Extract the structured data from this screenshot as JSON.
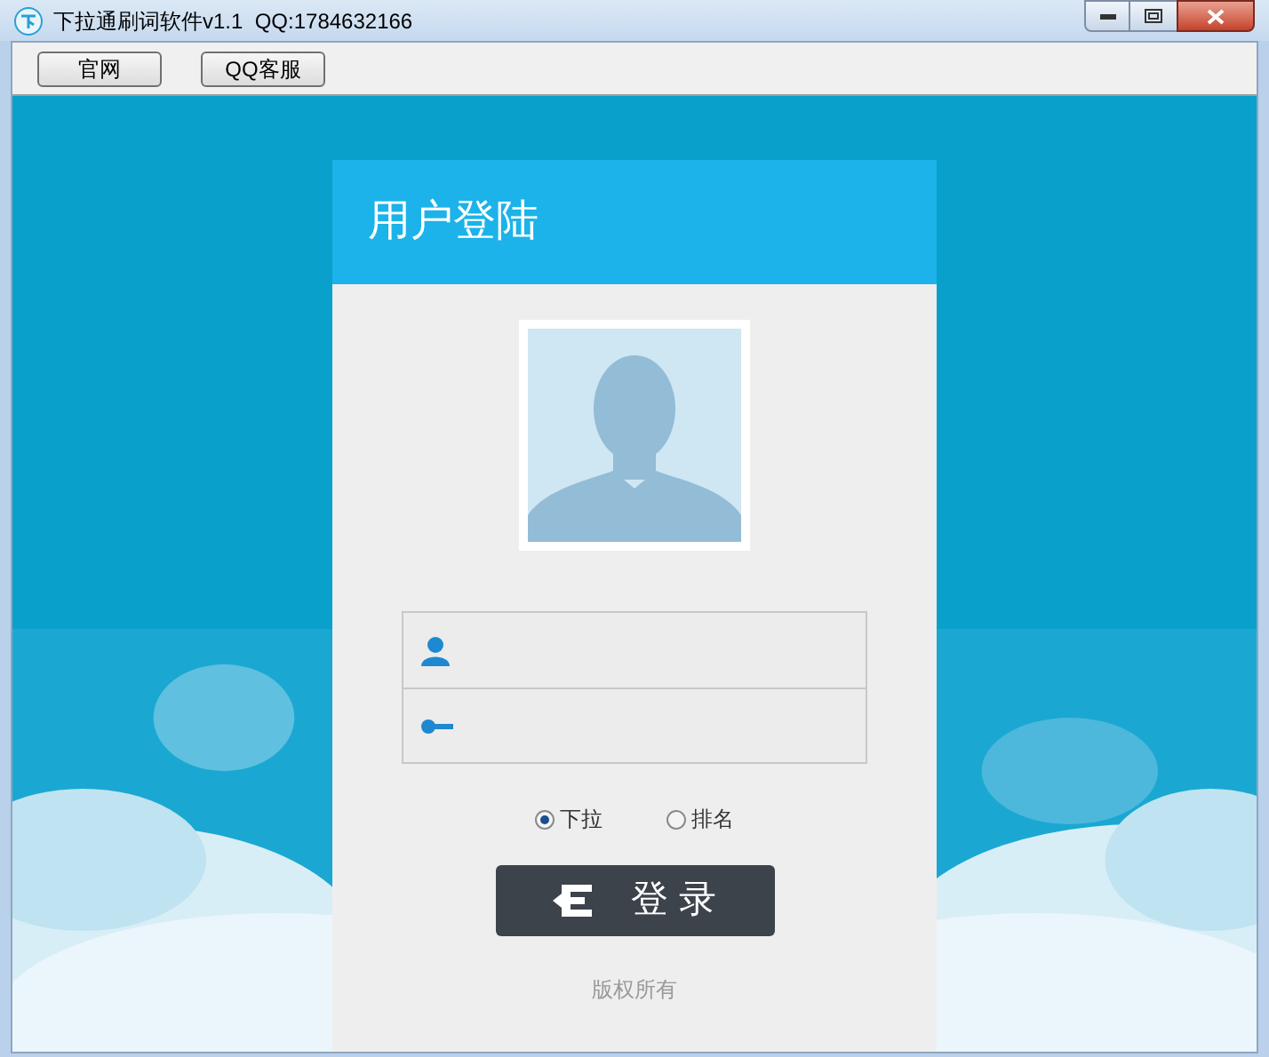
{
  "window": {
    "title": "下拉通刷词软件v1.1  QQ:1784632166"
  },
  "toolbar": {
    "buttons": [
      "官网",
      "QQ客服"
    ]
  },
  "login": {
    "title": "用户登陆",
    "fields": [
      {
        "kind": "user"
      },
      {
        "kind": "password"
      }
    ],
    "modes": [
      {
        "label": "下拉",
        "selected": true
      },
      {
        "label": "排名",
        "selected": false
      }
    ],
    "button": "登 录",
    "footer": "版权所有"
  }
}
